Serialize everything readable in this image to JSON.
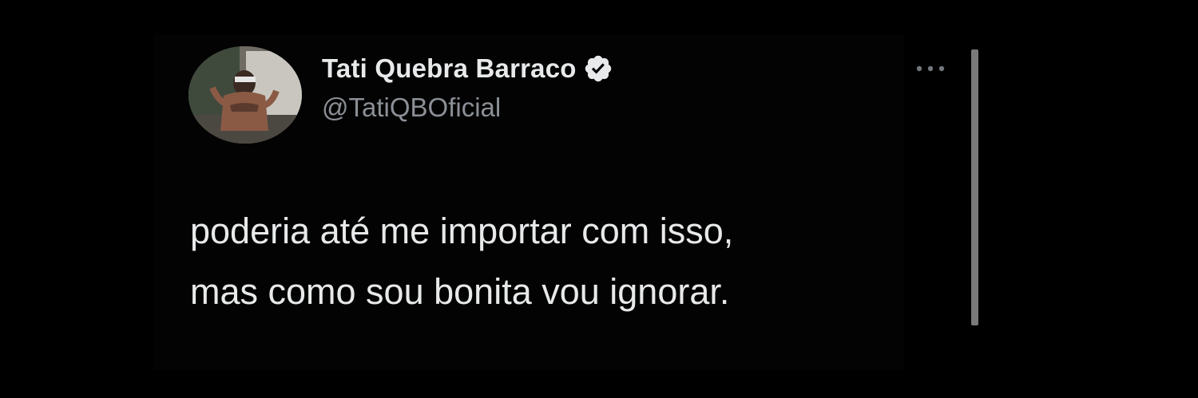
{
  "tweet": {
    "author": {
      "display_name": "Tati Quebra Barraco",
      "handle": "@TatiQBOficial",
      "verified_icon": "verified-badge-icon"
    },
    "text_lines": [
      "poderia até me importar com isso,",
      "mas como sou bonita vou ignorar."
    ],
    "more_icon": "more-options-icon"
  },
  "colors": {
    "background": "#000000",
    "primary_text": "#e7e9ea",
    "secondary_text": "#8b9096",
    "divider": "#7a7a7a"
  }
}
